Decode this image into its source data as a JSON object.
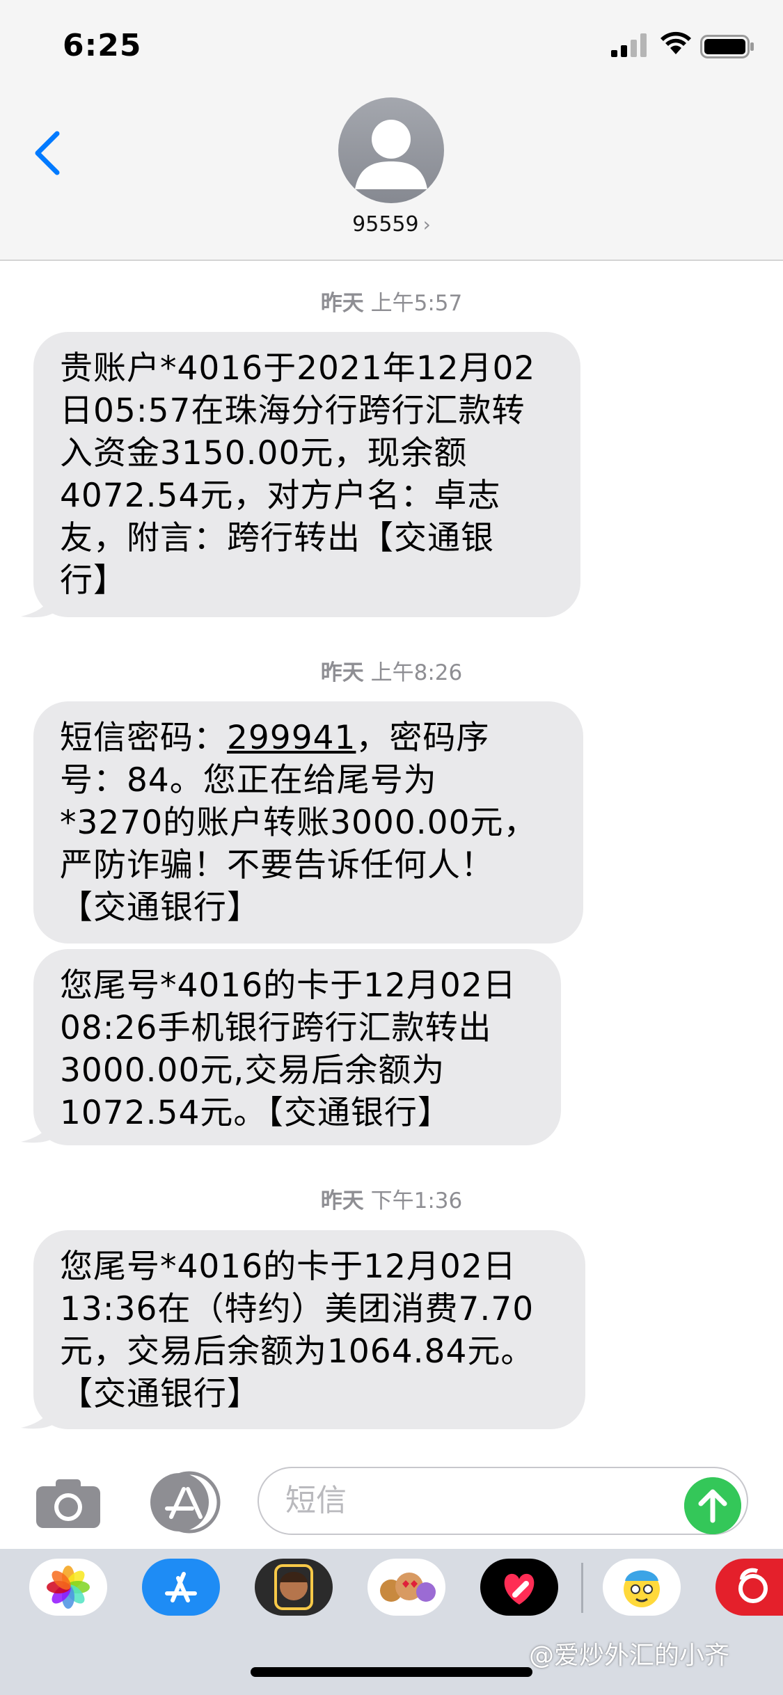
{
  "status_bar": {
    "time": "6:25"
  },
  "header": {
    "contact": "95559",
    "chevron": "›"
  },
  "messages": [
    {
      "timestamp_day": "昨天",
      "timestamp_time": "上午5:57",
      "bubbles": [
        {
          "lines": [
            "贵账户*4016于2021年12月02",
            "日05:57在珠海分行跨行汇款转",
            "入资金3150.00元，现余额",
            "4072.54元，对方户名：卓志",
            "友，附言：跨行转出【交通银",
            "行】"
          ]
        }
      ]
    },
    {
      "timestamp_day": "昨天",
      "timestamp_time": "上午8:26",
      "bubbles": [
        {
          "line1_prefix": "短信密码：",
          "code": "299941",
          "line1_suffix": "，密码序",
          "lines": [
            "号：84。您正在给尾号为",
            "*3270的账户转账3000.00元，",
            "严防诈骗！不要告诉任何人！",
            "【交通银行】"
          ]
        },
        {
          "lines": [
            "您尾号*4016的卡于12月02日",
            "08:26手机银行跨行汇款转出",
            "3000.00元,交易后余额为",
            "1072.54元。【交通银行】"
          ]
        }
      ]
    },
    {
      "timestamp_day": "昨天",
      "timestamp_time": "下午1:36",
      "bubbles": [
        {
          "lines": [
            "您尾号*4016的卡于12月02日",
            "13:36在（特约）美团消费7.70",
            "元，交易后余额为1064.84元。",
            "【交通银行】"
          ]
        }
      ]
    }
  ],
  "input": {
    "placeholder": "短信"
  },
  "app_drawer": {
    "apps": [
      "photos-icon",
      "app-store-icon",
      "memoji-icon",
      "animoji-icon",
      "digital-touch-icon",
      "sticker-app-icon",
      "netease-music-icon"
    ]
  },
  "watermark": "@爱炒外汇的小齐",
  "colors": {
    "bubble": "#e9e9eb",
    "accent": "#007aff",
    "send": "#34c759"
  }
}
